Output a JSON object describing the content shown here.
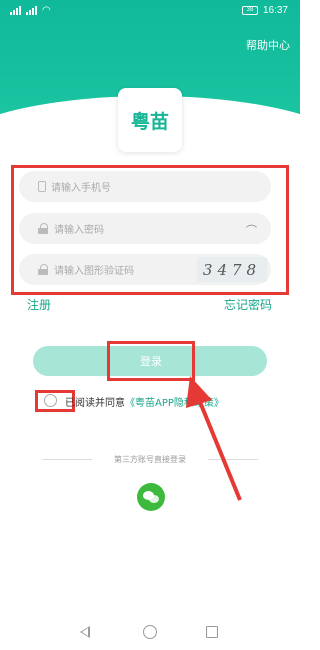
{
  "status_bar": {
    "time": "16:37",
    "battery": "38"
  },
  "header": {
    "help_label": "帮助中心"
  },
  "logo": {
    "text": "粤苗"
  },
  "form": {
    "phone_placeholder": "请输入手机号",
    "password_placeholder": "请输入密码",
    "captcha_placeholder": "请输入图形验证码",
    "captcha_text": "3478"
  },
  "links": {
    "register": "注册",
    "forgot_password": "忘记密码"
  },
  "login_button": "登录",
  "agreement": {
    "prefix": "已阅读并同意",
    "policy": "《粤苗APP隐私政策》"
  },
  "third_party": {
    "label": "第三方账号直接登录",
    "icon": "wechat-icon"
  },
  "colors": {
    "brand": "#16b596",
    "highlight": "#e53935",
    "login_button": "#a7e5d6"
  }
}
